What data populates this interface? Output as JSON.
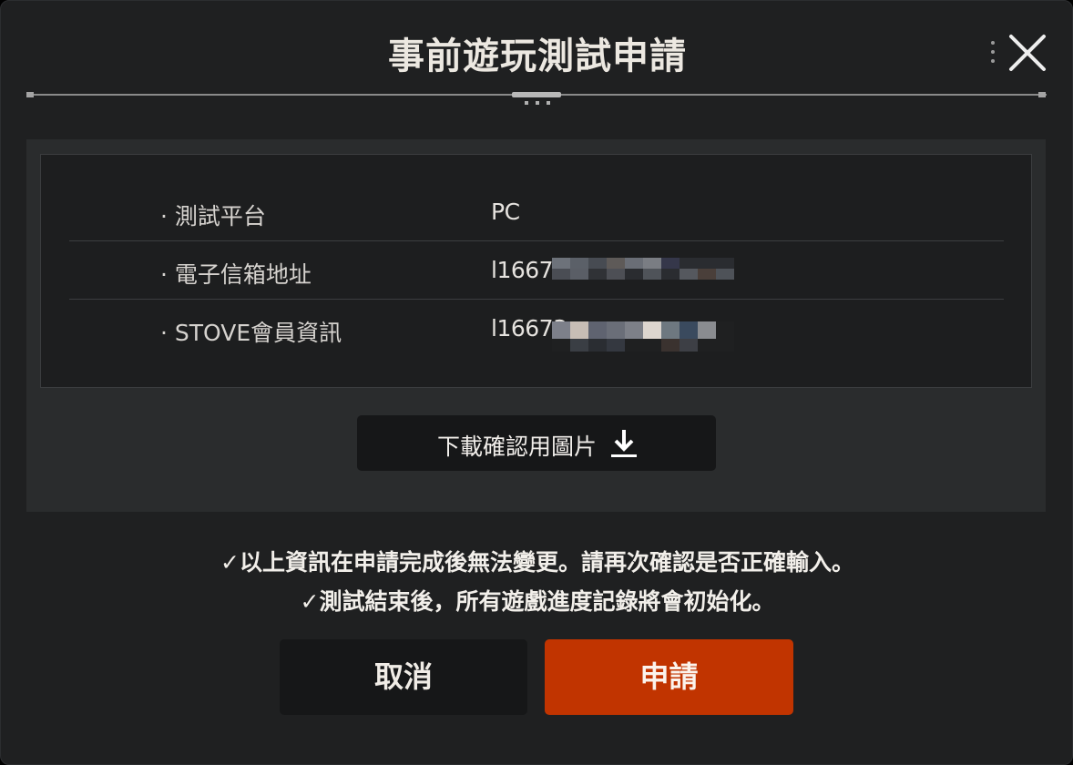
{
  "dialog": {
    "title": "事前遊玩測試申請"
  },
  "info_rows": [
    {
      "label": "· 測試平台",
      "value": "PC"
    },
    {
      "label": "· 電子信箱地址",
      "value": "l16673"
    },
    {
      "label": "· STOVE會員資訊",
      "value": "l16673"
    }
  ],
  "download_button": {
    "label": "下載確認用圖片",
    "icon": "download-icon"
  },
  "notices": [
    "✓以上資訊在申請完成後無法變更。請再次確認是否正確輸入。",
    "✓測試結束後，所有遊戲進度記錄將會初始化。"
  ],
  "buttons": {
    "cancel_label": "取消",
    "apply_label": "申請"
  },
  "colors": {
    "background": "#1f2021",
    "panel": "#2a2c2d",
    "accent": "#c13400"
  }
}
